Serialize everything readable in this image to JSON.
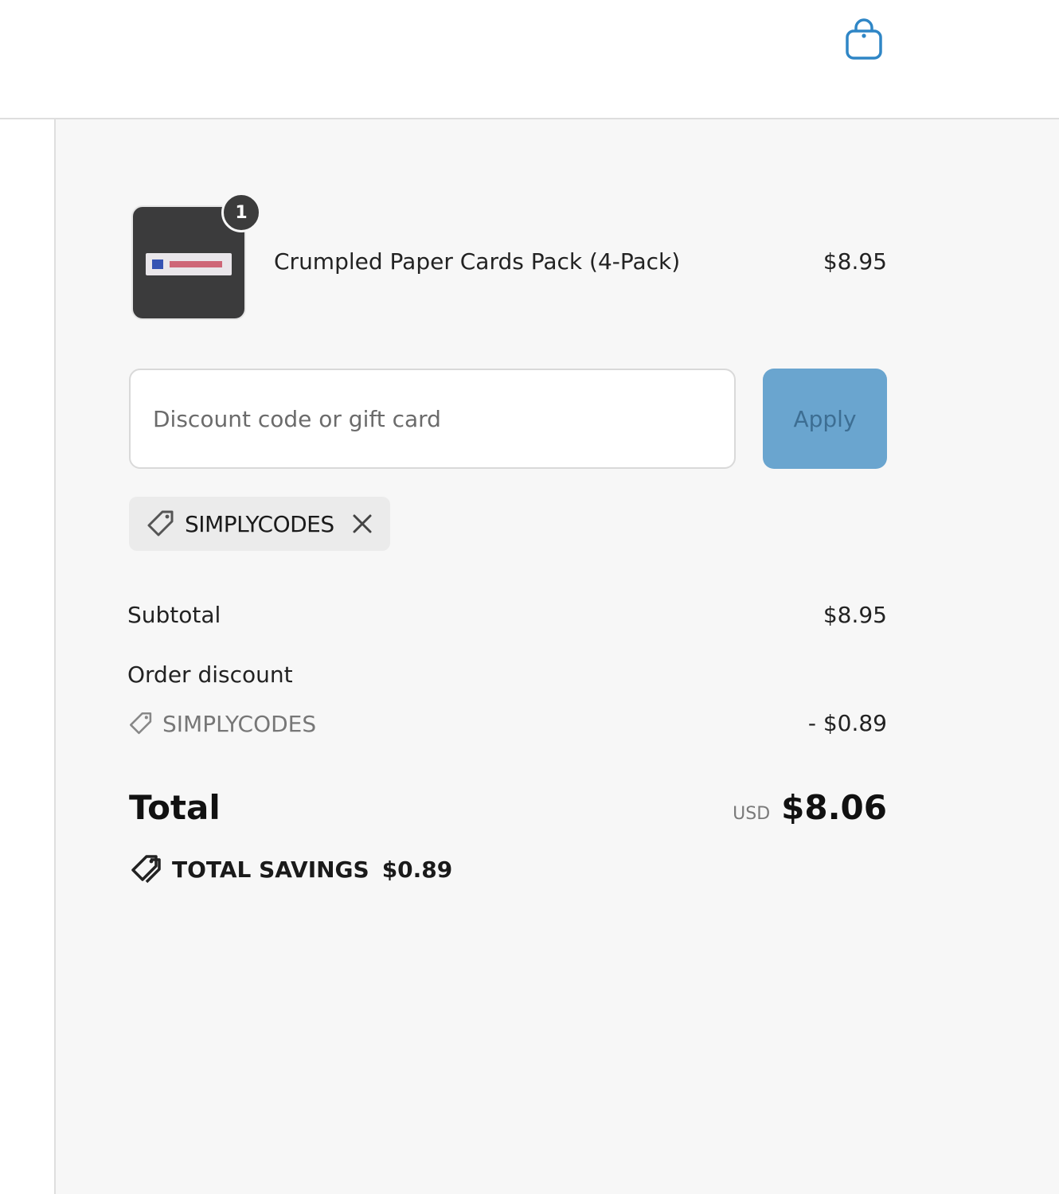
{
  "header": {
    "cart_icon": "shopping-bag-icon",
    "accent_color": "#2f86c6"
  },
  "cart": {
    "items": [
      {
        "name": "Crumpled Paper Cards Pack (4-Pack)",
        "price": "$8.95",
        "quantity": "1"
      }
    ]
  },
  "discount": {
    "placeholder": "Discount code or gift card",
    "value": "",
    "apply_label": "Apply",
    "applied_code": "SIMPLYCODES"
  },
  "summary": {
    "subtotal_label": "Subtotal",
    "subtotal_value": "$8.95",
    "order_discount_label": "Order discount",
    "discount_code": "SIMPLYCODES",
    "discount_value": "- $0.89",
    "total_label": "Total",
    "currency": "USD",
    "total_value": "$8.06",
    "savings_label": "TOTAL SAVINGS",
    "savings_value": "$0.89"
  }
}
